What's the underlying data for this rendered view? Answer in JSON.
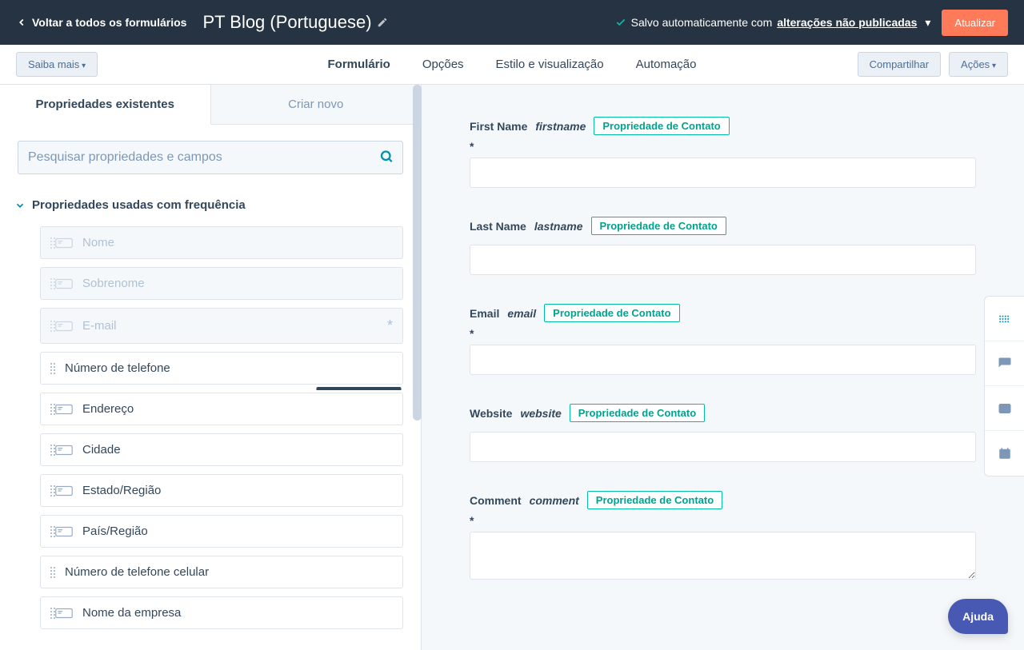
{
  "topbar": {
    "back_label": "Voltar a todos os formulários",
    "title": "PT Blog (Portuguese)",
    "autosave_prefix": "Salvo automaticamente com",
    "autosave_changes": "alterações não publicadas",
    "update_label": "Atualizar"
  },
  "secondbar": {
    "learn_more": "Saiba mais",
    "tabs": {
      "form": "Formulário",
      "options": "Opções",
      "style": "Estilo e visualização",
      "automation": "Automação"
    },
    "share": "Compartilhar",
    "actions": "Ações"
  },
  "sidebar": {
    "tabs": {
      "existing": "Propriedades existentes",
      "create": "Criar novo"
    },
    "search_placeholder": "Pesquisar propriedades e campos",
    "section_title": "Propriedades usadas com frequência",
    "props": [
      {
        "label": "Nome",
        "disabled": true,
        "has_icon": true,
        "required": false
      },
      {
        "label": "Sobrenome",
        "disabled": true,
        "has_icon": true,
        "required": false
      },
      {
        "label": "E-mail",
        "disabled": true,
        "has_icon": true,
        "required": true
      },
      {
        "label": "Número de telefone",
        "disabled": false,
        "has_icon": false,
        "required": false
      },
      {
        "label": "Endereço",
        "disabled": false,
        "has_icon": true,
        "required": false
      },
      {
        "label": "Cidade",
        "disabled": false,
        "has_icon": true,
        "required": false
      },
      {
        "label": "Estado/Região",
        "disabled": false,
        "has_icon": true,
        "required": false
      },
      {
        "label": "País/Região",
        "disabled": false,
        "has_icon": true,
        "required": false
      },
      {
        "label": "Número de telefone celular",
        "disabled": false,
        "has_icon": false,
        "required": false
      },
      {
        "label": "Nome da empresa",
        "disabled": false,
        "has_icon": true,
        "required": false
      }
    ]
  },
  "canvas": {
    "contact_badge": "Propriedade de Contato",
    "fields": [
      {
        "label": "First Name",
        "name": "firstname",
        "required": true,
        "multiline": false
      },
      {
        "label": "Last Name",
        "name": "lastname",
        "required": false,
        "multiline": false
      },
      {
        "label": "Email",
        "name": "email",
        "required": true,
        "multiline": false
      },
      {
        "label": "Website",
        "name": "website",
        "required": false,
        "multiline": false
      },
      {
        "label": "Comment",
        "name": "comment",
        "required": true,
        "multiline": true
      }
    ]
  },
  "help": {
    "label": "Ajuda"
  }
}
